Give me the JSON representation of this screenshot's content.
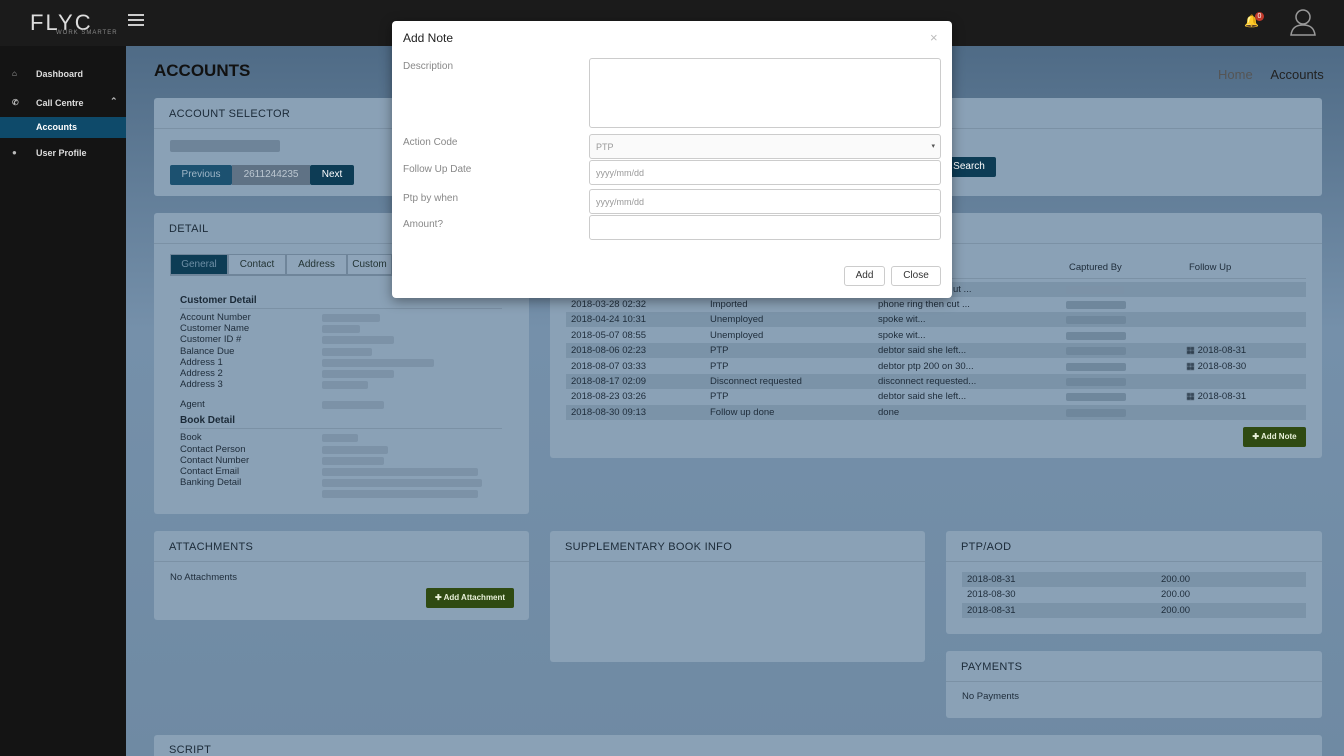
{
  "brand": {
    "logo_text": "FLYC",
    "tagline": "WORK SMARTER"
  },
  "topbar": {
    "notification_count": "0"
  },
  "sidebar": {
    "items": [
      {
        "label": "Dashboard",
        "icon": "home-icon"
      },
      {
        "label": "Call Centre",
        "icon": "phone-icon"
      },
      {
        "label": "Accounts",
        "icon": ""
      },
      {
        "label": "User Profile",
        "icon": "user-icon"
      }
    ]
  },
  "page": {
    "title": "ACCOUNTS",
    "breadcrumb": [
      "Home",
      "Accounts"
    ]
  },
  "account_selector": {
    "title": "ACCOUNT SELECTOR",
    "previous_label": "Previous",
    "account_number": "2611244235",
    "next_label": "Next",
    "search_label": "Search"
  },
  "detail": {
    "title": "DETAIL",
    "tabs": [
      "General",
      "Contact",
      "Address",
      "Custom"
    ],
    "customer_section": "Customer Detail",
    "customer_fields": [
      "Account Number",
      "Customer Name",
      "Customer ID #",
      "Balance Due",
      "Address 1",
      "Address 2",
      "Address 3"
    ],
    "agent_label": "Agent",
    "book_section": "Book Detail",
    "book_fields": [
      "Book",
      "Contact Person",
      "Contact Number",
      "Contact Email",
      "Banking Detail"
    ]
  },
  "notes": {
    "col_captured_by": "Captured By",
    "col_follow_up": "Follow Up",
    "first_row_note": "ut ...",
    "rows": [
      {
        "date": "2018-03-28 02:32",
        "action": "Imported",
        "note": "phone ring then cut ...",
        "follow": ""
      },
      {
        "date": "2018-04-24 10:31",
        "action": "Unemployed",
        "note": "spoke wit...",
        "follow": ""
      },
      {
        "date": "2018-05-07 08:55",
        "action": "Unemployed",
        "note": "spoke wit...",
        "follow": ""
      },
      {
        "date": "2018-08-06 02:23",
        "action": "PTP",
        "note": "debtor said she left...",
        "follow": "2018-08-31"
      },
      {
        "date": "2018-08-07 03:33",
        "action": "PTP",
        "note": "debtor ptp 200 on 30...",
        "follow": "2018-08-30"
      },
      {
        "date": "2018-08-17 02:09",
        "action": "Disconnect requested",
        "note": "disconnect requested...",
        "follow": ""
      },
      {
        "date": "2018-08-23 03:26",
        "action": "PTP",
        "note": "debtor said she left...",
        "follow": "2018-08-31"
      },
      {
        "date": "2018-08-30 09:13",
        "action": "Follow up done",
        "note": "done",
        "follow": ""
      }
    ],
    "add_note_label": "Add Note"
  },
  "attachments": {
    "title": "ATTACHMENTS",
    "empty_text": "No Attachments",
    "add_label": "Add Attachment"
  },
  "supplementary": {
    "title": "SUPPLEMENTARY BOOK INFO"
  },
  "ptp_aod": {
    "title": "PTP/AOD",
    "rows": [
      {
        "date": "2018-08-31",
        "amount": "200.00"
      },
      {
        "date": "2018-08-30",
        "amount": "200.00"
      },
      {
        "date": "2018-08-31",
        "amount": "200.00"
      }
    ]
  },
  "payments": {
    "title": "PAYMENTS",
    "empty_text": "No Payments"
  },
  "script": {
    "title": "SCRIPT"
  },
  "modal": {
    "title": "Add Note",
    "close_glyph": "×",
    "description_label": "Description",
    "action_code_label": "Action Code",
    "action_code_value": "PTP",
    "follow_up_label": "Follow Up Date",
    "follow_up_placeholder": "yyyy/mm/dd",
    "ptp_label": "Ptp by when",
    "ptp_placeholder": "yyyy/mm/dd",
    "amount_label": "Amount?",
    "add_label": "Add",
    "close_label": "Close"
  }
}
